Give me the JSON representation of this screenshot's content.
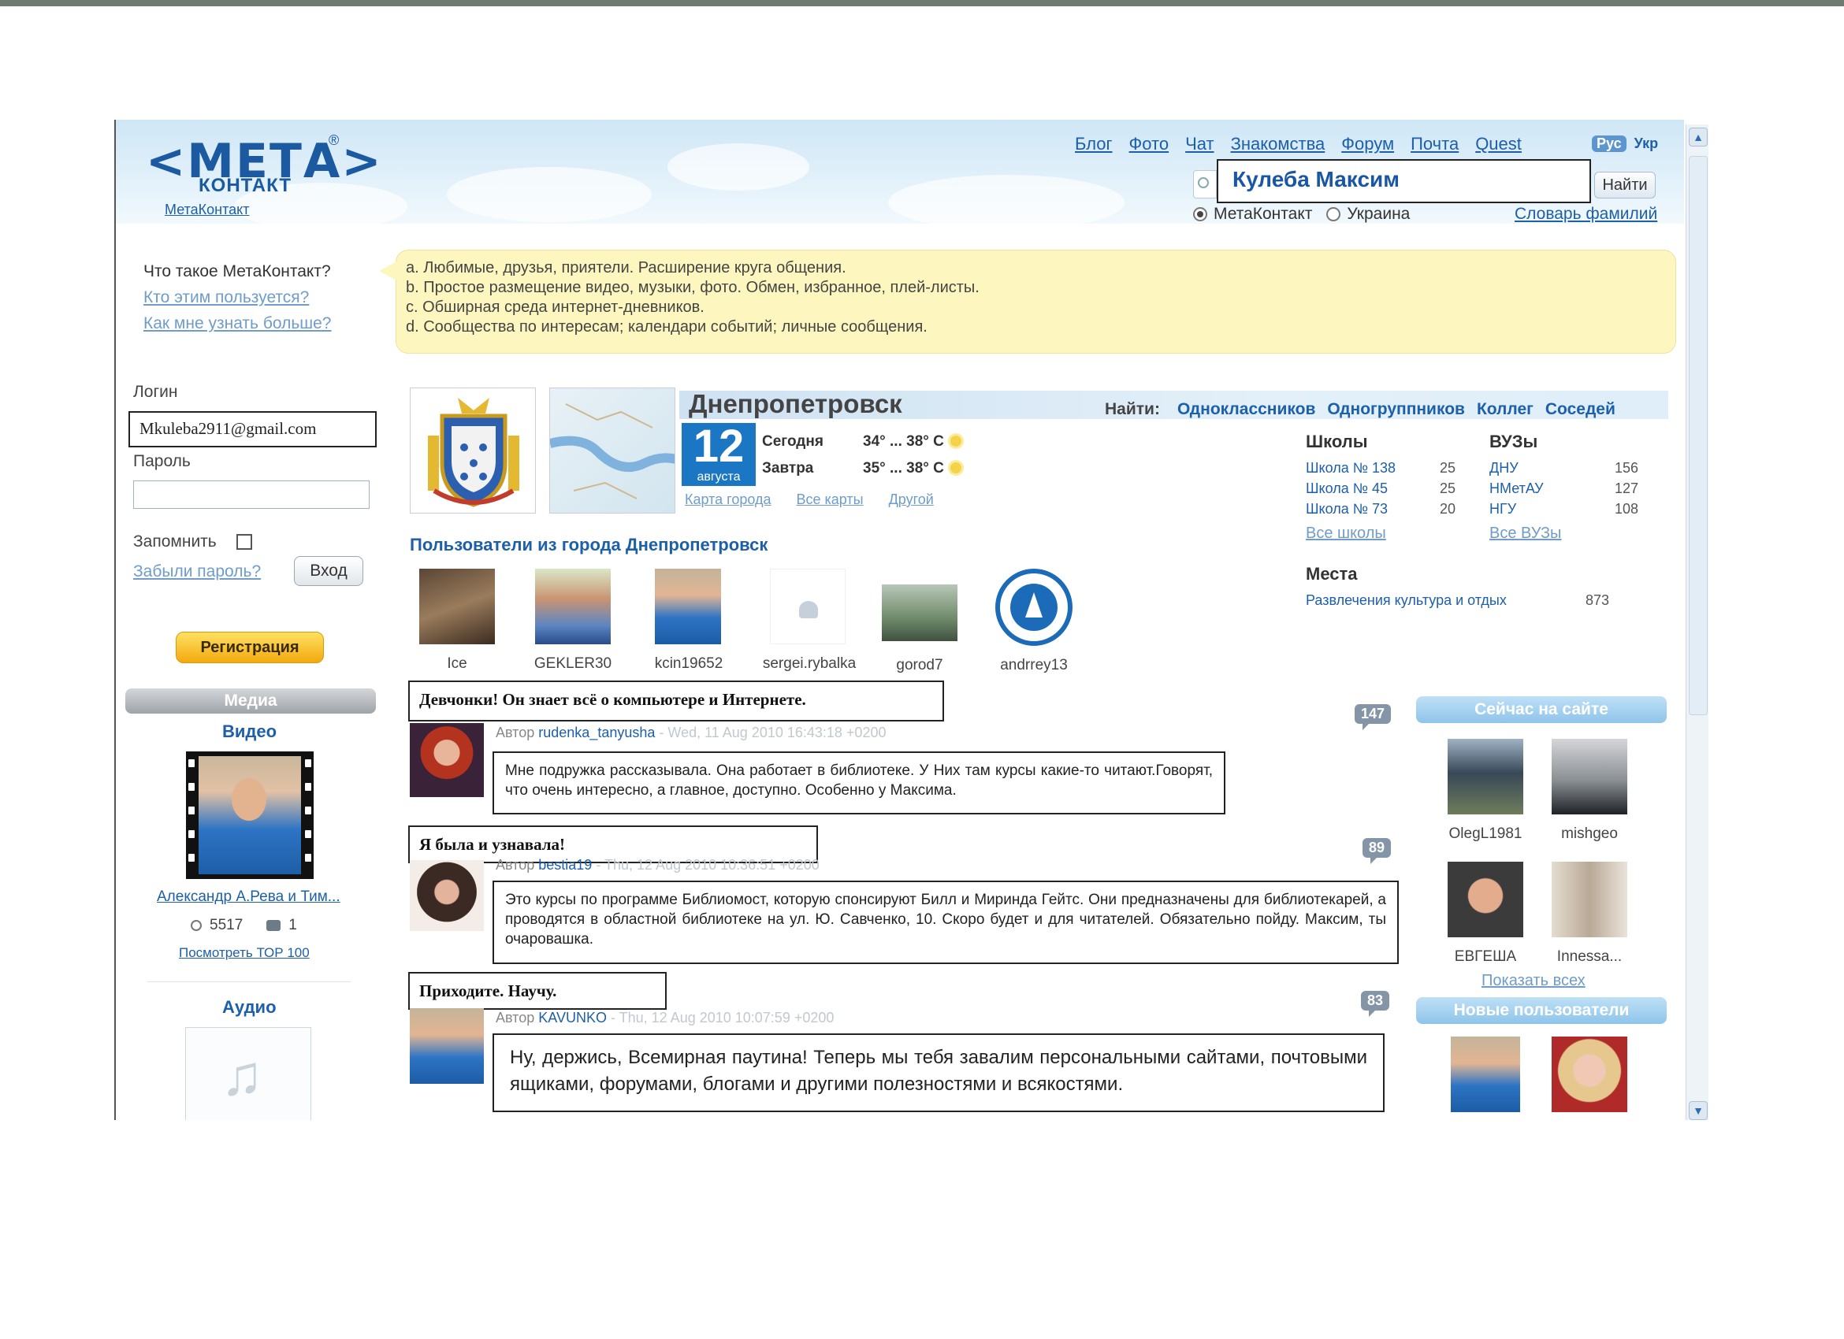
{
  "logo": {
    "text": "<МЕТА>",
    "sub": "КОНТАКТ",
    "reg": "®",
    "link": "МетаКонтакт"
  },
  "topnav": [
    "Блог",
    "Фото",
    "Чат",
    "Знакомства",
    "Форум",
    "Почта",
    "Quest"
  ],
  "lang": {
    "active": "Рус",
    "other": "Укр"
  },
  "search": {
    "value": "Кулеба Максим",
    "button": "Найти",
    "scope_options": [
      "МетаКонтакт",
      "Украина"
    ],
    "scope_selected": "МетаКонтакт",
    "dictionary_link": "Словарь фамилий"
  },
  "intro": {
    "question": "Что такое МетаКонтакт?",
    "links": [
      "Кто этим пользуется?",
      "Как мне узнать больше?"
    ],
    "points": [
      "a.  Любимые, друзья, приятели. Расширение круга общения.",
      "b.  Простое размещение видео, музыки, фото. Обмен, избранное, плей-листы.",
      "c.  Обширная среда интернет-дневников.",
      "d.  Сообщества по интересам; календари событий; личные сообщения."
    ]
  },
  "login": {
    "login_label": "Логин",
    "login_value": "Mkuleba2911@gmail.com",
    "password_label": "Пароль",
    "remember_label": "Запомнить",
    "forgot_link": "Забыли пароль?",
    "enter_button": "Вход",
    "register_button": "Регистрация"
  },
  "media": {
    "title": "Медиа",
    "video_title": "Видео",
    "video_link": "Александр А.Рева и Тим...",
    "views": "5517",
    "comments": "1",
    "top_link": "Посмотреть ТОР 100",
    "audio_title": "Аудио"
  },
  "city": {
    "name": "Днепропетровск",
    "find_label": "Найти:",
    "find_links": [
      "Одноклассников",
      "Одногруппников",
      "Коллег",
      "Соседей"
    ],
    "date_day": "12",
    "date_month": "августа",
    "weather": [
      {
        "day": "Сегодня",
        "temp": "34° ... 38° С"
      },
      {
        "day": "Завтра",
        "temp": "35° ... 38° С"
      }
    ],
    "map_links": [
      "Карта города",
      "Все карты",
      "Другой"
    ]
  },
  "schools": {
    "title": "Школы",
    "items": [
      {
        "name": "Школа № 138",
        "count": "25"
      },
      {
        "name": "Школа № 45",
        "count": "25"
      },
      {
        "name": "Школа № 73",
        "count": "20"
      }
    ],
    "all_link": "Все школы"
  },
  "universities": {
    "title": "ВУЗы",
    "items": [
      {
        "name": "ДНУ",
        "count": "156"
      },
      {
        "name": "НМетАУ",
        "count": "127"
      },
      {
        "name": "НГУ",
        "count": "108"
      }
    ],
    "all_link": "Все ВУЗы"
  },
  "places": {
    "title": "Места",
    "item": "Развлечения культура и отдых",
    "count": "873"
  },
  "city_users": {
    "title": "Пользователи из города Днепропетровск",
    "names": [
      "Ice",
      "GEKLER30",
      "kcin19652",
      "sergei.rybalka",
      "gorod7",
      "andrrey13"
    ]
  },
  "posts": [
    {
      "title": "Девчонки! Он знает всё о компьютере и Интернете.",
      "author_prefix": "Автор",
      "author": "rudenka_tanyusha",
      "date": "- Wed, 11 Aug 2010 16:43:18 +0200",
      "count": "147",
      "body": "Мне подружка рассказывала. Она работает в библиотеке. У Них там курсы какие-то читают.Говорят, что очень интересно, а главное, доступно. Особенно у Максима."
    },
    {
      "title": "Я была и узнавала!",
      "author_prefix": "Автор",
      "author": "bestia19",
      "date": "- Thu, 12 Aug 2010 10:36:51 +0200",
      "count": "89",
      "body": "Это курсы по программе Библиомост, которую спонсируют Билл и Миринда Гейтс. Они предназначены для библиотекарей, а проводятся в областной библиотеке на ул. Ю. Савченко, 10. Скоро будет и для читателей. Обязательно пойду. Максим, ты очаровашка."
    },
    {
      "title": "Приходите. Научу.",
      "author_prefix": "Автор",
      "author": "KAVUNKO",
      "date": "- Thu, 12 Aug 2010 10:07:59 +0200",
      "count": "83",
      "body": "Ну, держись, Всемирная паутина! Теперь мы тебя завалим персональными сайтами, почтовыми ящиками, форумами, блогами и другими полезностями и всякостями."
    }
  ],
  "online": {
    "title": "Сейчас на сайте",
    "names": [
      "OlegL1981",
      "mishgeo",
      "ЕВГЕША",
      "Innessa..."
    ],
    "show_all": "Показать всех"
  },
  "new_users": {
    "title": "Новые пользователи"
  },
  "colors": {
    "link": "#1d5fa8",
    "header_sky": "#cfe6f6",
    "bubble": "#fdf7bf",
    "register": "#f3a90e",
    "date_box": "#1b76c4"
  }
}
